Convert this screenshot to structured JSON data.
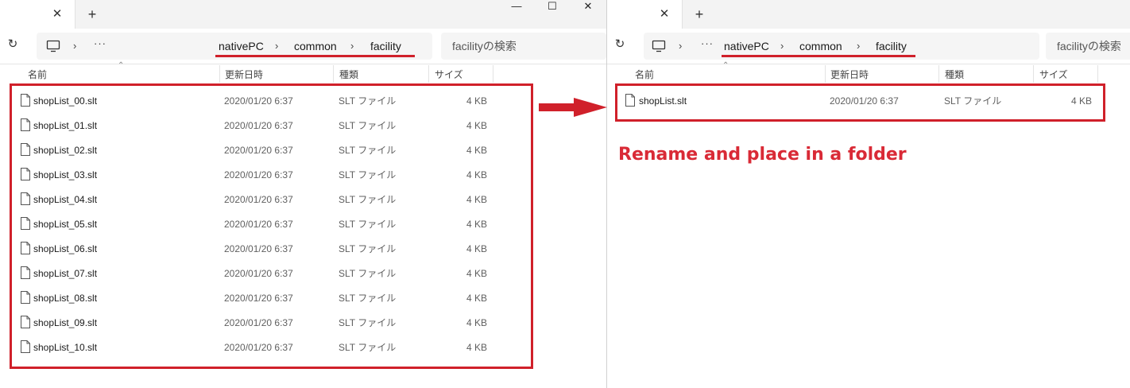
{
  "colors": {
    "highlight": "#d0202a",
    "annotation": "#d92a36"
  },
  "icons": {
    "refresh": "refresh-icon",
    "computer": "computer-icon",
    "file": "file-icon",
    "close_tab": "close-icon",
    "new_tab": "plus-icon"
  },
  "left": {
    "tab_close": "✕",
    "new_tab": "+",
    "window": {
      "minimize": "—",
      "maximize": "☐",
      "close": "✕"
    },
    "breadcrumb": [
      "nativePC",
      "common",
      "facility"
    ],
    "search_placeholder": "facilityの検索",
    "columns": {
      "name": "名前",
      "modified": "更新日時",
      "type": "種類",
      "size": "サイズ"
    },
    "files": [
      {
        "name": "shopList_00.slt",
        "modified": "2020/01/20 6:37",
        "type": "SLT ファイル",
        "size": "4 KB"
      },
      {
        "name": "shopList_01.slt",
        "modified": "2020/01/20 6:37",
        "type": "SLT ファイル",
        "size": "4 KB"
      },
      {
        "name": "shopList_02.slt",
        "modified": "2020/01/20 6:37",
        "type": "SLT ファイル",
        "size": "4 KB"
      },
      {
        "name": "shopList_03.slt",
        "modified": "2020/01/20 6:37",
        "type": "SLT ファイル",
        "size": "4 KB"
      },
      {
        "name": "shopList_04.slt",
        "modified": "2020/01/20 6:37",
        "type": "SLT ファイル",
        "size": "4 KB"
      },
      {
        "name": "shopList_05.slt",
        "modified": "2020/01/20 6:37",
        "type": "SLT ファイル",
        "size": "4 KB"
      },
      {
        "name": "shopList_06.slt",
        "modified": "2020/01/20 6:37",
        "type": "SLT ファイル",
        "size": "4 KB"
      },
      {
        "name": "shopList_07.slt",
        "modified": "2020/01/20 6:37",
        "type": "SLT ファイル",
        "size": "4 KB"
      },
      {
        "name": "shopList_08.slt",
        "modified": "2020/01/20 6:37",
        "type": "SLT ファイル",
        "size": "4 KB"
      },
      {
        "name": "shopList_09.slt",
        "modified": "2020/01/20 6:37",
        "type": "SLT ファイル",
        "size": "4 KB"
      },
      {
        "name": "shopList_10.slt",
        "modified": "2020/01/20 6:37",
        "type": "SLT ファイル",
        "size": "4 KB"
      }
    ]
  },
  "right": {
    "tab_close": "✕",
    "new_tab": "+",
    "breadcrumb": [
      "nativePC",
      "common",
      "facility"
    ],
    "search_placeholder": "facilityの検索",
    "columns": {
      "name": "名前",
      "modified": "更新日時",
      "type": "種類",
      "size": "サイズ"
    },
    "files": [
      {
        "name": "shopList.slt",
        "modified": "2020/01/20 6:37",
        "type": "SLT ファイル",
        "size": "4 KB"
      }
    ]
  },
  "annotation": "Rename and place in a folder"
}
